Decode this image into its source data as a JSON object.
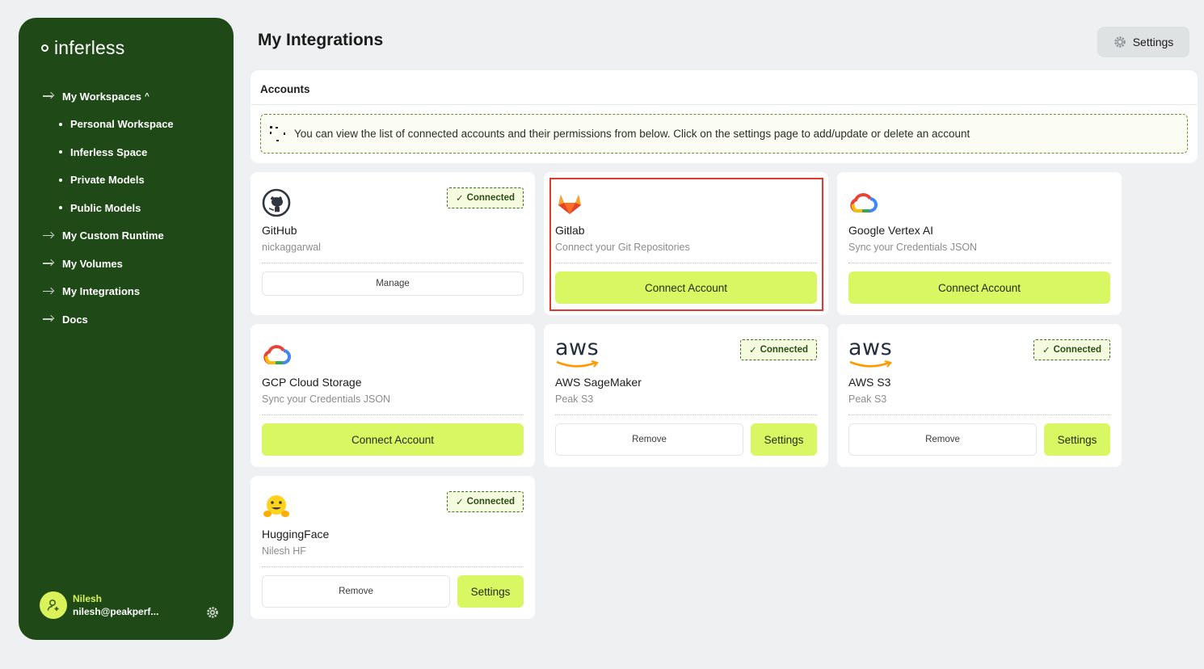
{
  "sidebar": {
    "logo": "inferless",
    "items": [
      {
        "label": "My Workspaces",
        "type": "group"
      },
      {
        "label": "Personal Workspace",
        "type": "sub"
      },
      {
        "label": "Inferless Space",
        "type": "sub"
      },
      {
        "label": "Private Models",
        "type": "sub"
      },
      {
        "label": "Public Models",
        "type": "sub"
      },
      {
        "label": "My Custom Runtime",
        "type": "item"
      },
      {
        "label": "My Volumes",
        "type": "item"
      },
      {
        "label": "My Integrations",
        "type": "item"
      },
      {
        "label": "Docs",
        "type": "item"
      }
    ],
    "user": {
      "name": "Nilesh",
      "email": "nilesh@peakperf..."
    }
  },
  "header": {
    "title": "My Integrations",
    "settings_label": "Settings"
  },
  "accounts": {
    "title": "Accounts",
    "info": "You can view the list of connected accounts and their permissions from below. Click on the settings page to add/update or delete an account"
  },
  "cards": [
    {
      "name": "GitHub",
      "sub": "nickaggarwal",
      "badge": "Connected",
      "primary": "Manage",
      "icon": "github-icon"
    },
    {
      "name": "Gitlab",
      "sub": "Connect your Git Repositories",
      "primary": "Connect Account",
      "icon": "gitlab-icon"
    },
    {
      "name": "Google Vertex AI",
      "sub": "Sync your Credentials JSON",
      "primary": "Connect Account",
      "icon": "google-cloud-icon"
    },
    {
      "name": "GCP Cloud Storage",
      "sub": "Sync your Credentials JSON",
      "primary": "Connect Account",
      "icon": "google-cloud-icon"
    },
    {
      "name": "AWS SageMaker",
      "sub": "Peak S3",
      "badge": "Connected",
      "primary": "Remove",
      "secondary": "Settings",
      "icon": "aws-icon",
      "logo_text": "aws"
    },
    {
      "name": "AWS S3",
      "sub": "Peak S3",
      "badge": "Connected",
      "primary": "Remove",
      "secondary": "Settings",
      "icon": "aws-icon",
      "logo_text": "aws"
    },
    {
      "name": "HuggingFace",
      "sub": "Nilesh HF",
      "badge": "Connected",
      "primary": "Remove",
      "secondary": "Settings",
      "icon": "huggingface-icon"
    }
  ],
  "colors": {
    "sidebar": "#1f4a17",
    "accent": "#d8f763",
    "highlight": "#e03a2f"
  }
}
